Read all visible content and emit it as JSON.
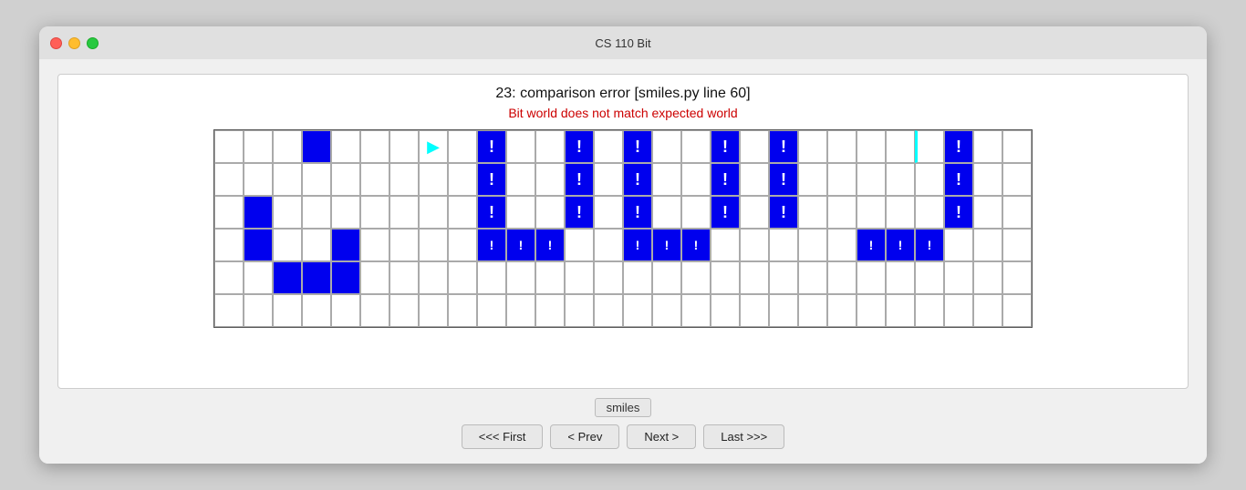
{
  "window": {
    "title": "CS 110 Bit"
  },
  "error": {
    "main": "23: comparison error  [smiles.py line 60]",
    "sub": "Bit world does not match expected world"
  },
  "test_label": "smiles",
  "nav": {
    "first": "<<< First",
    "prev": "< Prev",
    "next": "Next >",
    "last": "Last >>>"
  },
  "grid": {
    "cols": 28,
    "rows": 6
  }
}
